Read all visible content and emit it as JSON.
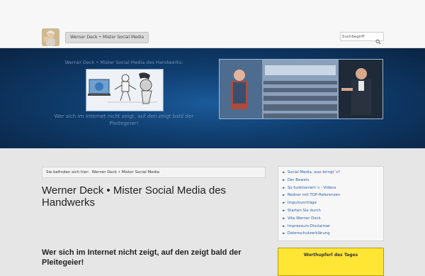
{
  "header": {
    "site_title": "Werner Deck • Mister Social Media",
    "search_placeholder": "Suchbegriff"
  },
  "hero": {
    "title": "Werner Deck • Mister Social Media des Handwerks:",
    "tagline": "Wer sich im Internet nicht zeigt, auf den zeigt bald der Pleitegeier!"
  },
  "breadcrumb": {
    "prefix": "Sie befinden sich hier:",
    "current": "Werner Deck • Mister Social Media"
  },
  "main": {
    "title": "Werner Deck • Mister Social Media des Handwerks",
    "subheading": "Wer sich im Internet nicht zeigt, auf den zeigt bald der Pleitegeier!"
  },
  "sidebar": {
    "menu": [
      "Social Media, was bringt´s?",
      "Der Beweis",
      "So funktioniert´s - Videos",
      "Redner mit TOP-Referenzen",
      "Impulsvorträge",
      "Starten Sie durch",
      "Vita Werner Deck",
      "Impressum-Disclaimer",
      "Datenschutzerklärung"
    ],
    "widget_title": "Worthupferl des Tages"
  },
  "colors": {
    "link": "#2b5fa6",
    "hero_bg": "#0f3d6e",
    "widget_bg": "#ffe635"
  }
}
